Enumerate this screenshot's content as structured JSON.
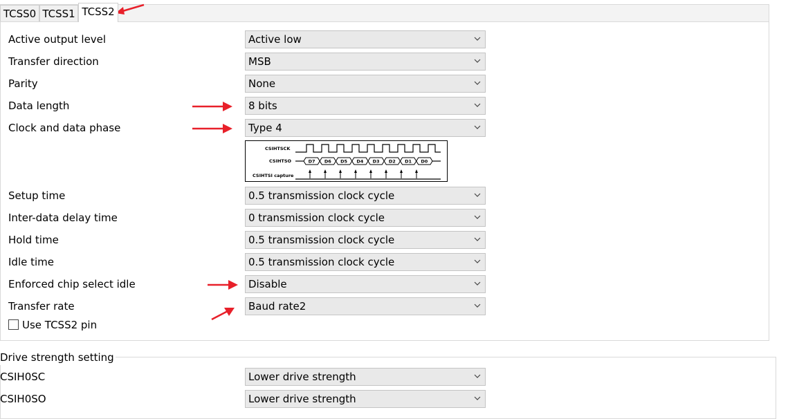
{
  "tabs": [
    {
      "label": "TCSS0",
      "active": false
    },
    {
      "label": "TCSS1",
      "active": false
    },
    {
      "label": "TCSS2",
      "active": true
    }
  ],
  "settings": [
    {
      "label": "Active output level",
      "value": "Active low"
    },
    {
      "label": "Transfer direction",
      "value": "MSB"
    },
    {
      "label": "Parity",
      "value": "None"
    },
    {
      "label": "Data length",
      "value": "8 bits"
    },
    {
      "label": "Clock and data phase",
      "value": "Type 4"
    },
    {
      "label": "Setup time",
      "value": "0.5 transmission clock cycle"
    },
    {
      "label": "Inter-data delay time",
      "value": "0 transmission clock cycle"
    },
    {
      "label": "Hold time",
      "value": "0.5 transmission clock cycle"
    },
    {
      "label": "Idle time",
      "value": "0.5 transmission clock cycle"
    },
    {
      "label": "Enforced chip select idle",
      "value": "Disable"
    },
    {
      "label": "Transfer rate",
      "value": "Baud rate2"
    }
  ],
  "diagram": {
    "sck_label": "CSIHTSCK",
    "so_label": "CSIHTSO",
    "capture_label": "CSIHTSI capture",
    "bits": [
      "D7",
      "D6",
      "D5",
      "D4",
      "D3",
      "D2",
      "D1",
      "D0"
    ]
  },
  "use_pin": {
    "label": "Use TCSS2 pin",
    "checked": false
  },
  "drive_strength": {
    "title": "Drive strength setting",
    "rows": [
      {
        "label": "CSIH0SC",
        "value": "Lower drive strength"
      },
      {
        "label": "CSIH0SO",
        "value": "Lower drive strength"
      }
    ]
  },
  "colors": {
    "annotation_arrow": "#e8202a",
    "select_bg": "#e9e9e9"
  }
}
